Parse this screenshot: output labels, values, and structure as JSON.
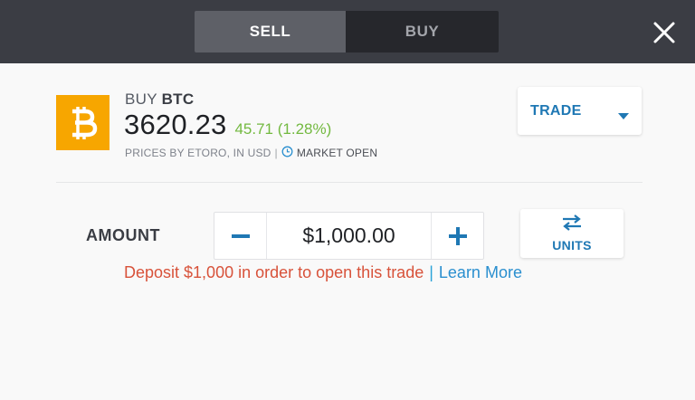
{
  "header": {
    "tabs": [
      {
        "label": "SELL",
        "active": true
      },
      {
        "label": "BUY",
        "active": false
      }
    ],
    "close_icon": "close-icon"
  },
  "asset": {
    "action": "BUY",
    "symbol": "BTC",
    "price": "3620.23",
    "change": "45.71 (1.28%)",
    "prices_note": "PRICES BY ETORO, IN USD",
    "separator": "|",
    "market_status": "MARKET OPEN",
    "logo_icon": "bitcoin-icon",
    "logo_color": "#f7a600",
    "change_color": "#73b940"
  },
  "order_type": {
    "selected": "TRADE"
  },
  "amount": {
    "label": "AMOUNT",
    "value": "$1,000.00",
    "units_label": "UNITS"
  },
  "message": {
    "warning": "Deposit $1,000 in order to open this trade",
    "separator": "|",
    "link": "Learn More",
    "warning_color": "#d8523a"
  },
  "accent_color": "#1f78b4"
}
